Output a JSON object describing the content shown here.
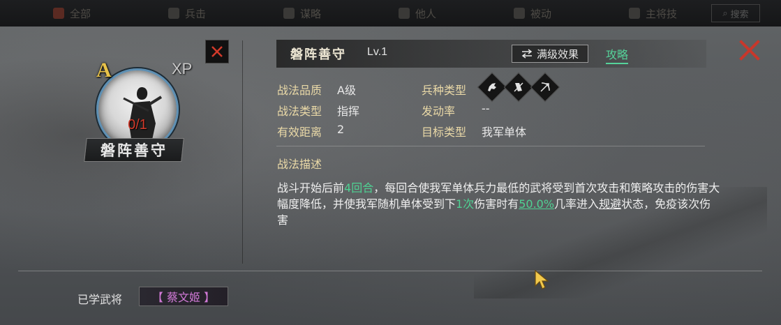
{
  "topbar": {
    "tabs": [
      {
        "label": "全部"
      },
      {
        "label": "兵击"
      },
      {
        "label": "谋略"
      },
      {
        "label": "他人"
      },
      {
        "label": "被动"
      },
      {
        "label": "主将技"
      }
    ],
    "search_label": "搜索"
  },
  "skill": {
    "grade": "A",
    "xp_label": "XP",
    "count": "0/1",
    "name": "磐阵善守",
    "level": "Lv.1"
  },
  "header": {
    "max_effect_label": "满级效果",
    "guide_label": "攻略"
  },
  "attributes": {
    "quality_key": "战法品质",
    "quality_val": "A级",
    "type_key": "战法类型",
    "type_val": "指挥",
    "range_key": "有效距离",
    "range_val": "2",
    "troop_key": "兵种类型",
    "trigger_key": "发动率",
    "trigger_val": "--",
    "target_key": "目标类型",
    "target_val": "我军单体",
    "troop_icons": [
      "cavalry-icon",
      "shield-icon",
      "bow-icon"
    ]
  },
  "description": {
    "title": "战法描述",
    "p1": "战斗开始后前",
    "p2": "4回合",
    "p3": "，每回合使我军单体兵力最低的武将受到首次攻击和策略攻击的伤害大幅度降低，并使我军随机单体受到下",
    "p4": "1次",
    "p5": "伤害时有",
    "p6": "50.0%",
    "p7": "几率进入",
    "p8": "规避",
    "p9": "状态，免疫该次伤害"
  },
  "learned": {
    "label": "已学武将",
    "generals": [
      "【 蔡文姬 】"
    ]
  },
  "colors": {
    "accent_green": "#4fd193",
    "grade_gold": "#e7c24a",
    "close_red": "#d23a2a",
    "general_purple": "#d27ad8"
  }
}
